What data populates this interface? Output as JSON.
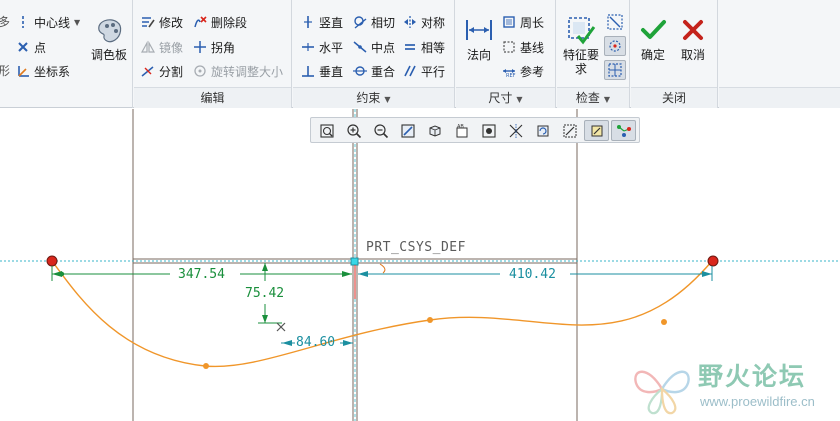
{
  "ribbon": {
    "left_group": {
      "prefix_chars": [
        "多",
        "形"
      ],
      "centerline": "中心线",
      "point": "点",
      "csys": "坐标系",
      "palette": "调色板"
    },
    "edit": {
      "label": "编辑",
      "modify": "修改",
      "delete_segment": "删除段",
      "mirror": "镜像",
      "corner": "拐角",
      "divide": "分割",
      "rotate_resize": "旋转调整大小"
    },
    "constraint": {
      "label": "约束",
      "vertical": "竖直",
      "tangent": "相切",
      "symmetric": "对称",
      "horizontal": "水平",
      "midpoint": "中点",
      "equal": "相等",
      "perpendicular": "垂直",
      "coincident": "重合",
      "parallel": "平行"
    },
    "dimension": {
      "label": "尺寸",
      "normal": "法向",
      "perimeter": "周长",
      "baseline": "基线",
      "reference": "参考"
    },
    "inspect": {
      "label": "检查",
      "feature_req": "特征要求"
    },
    "close": {
      "label": "关闭",
      "ok": "确定",
      "cancel": "取消"
    }
  },
  "canvas": {
    "csys_label": "PRT_CSYS_DEF",
    "dimensions": {
      "left_horizontal": "347.54",
      "vertical": "75.42",
      "right_horizontal": "410.42",
      "small": "84.60"
    }
  },
  "watermark": {
    "title": "野火论坛",
    "url": "www.proewildfire.cn"
  },
  "colors": {
    "spline": "#f0962a",
    "dimension_green": "#1a8f3c",
    "dimension_teal": "#1b8fa0",
    "reference_line": "#7a6a5f",
    "centerline_dotted": "#38b6c8",
    "endpoint_red": "#d9261c"
  }
}
